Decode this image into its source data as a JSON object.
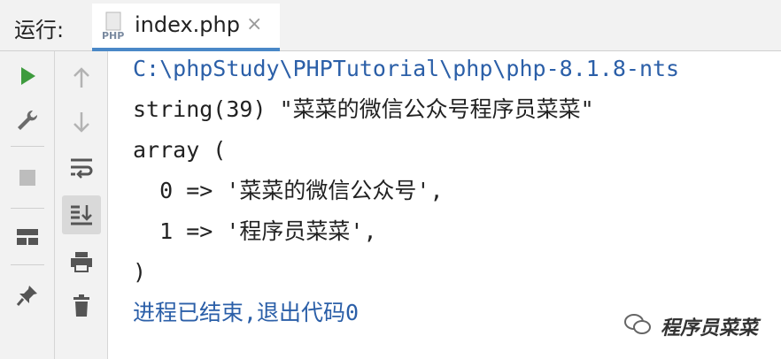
{
  "header": {
    "run_label": "运行:",
    "tab": {
      "icon": "php-file-icon",
      "title": "index.php",
      "close_glyph": "×"
    }
  },
  "toolbar_left": [
    {
      "icon": "run-icon",
      "color": "#3e9b3e"
    },
    {
      "icon": "wrench-icon"
    },
    {
      "icon": "stop-icon"
    },
    {
      "icon": "layout-icon"
    },
    {
      "icon": "pin-icon"
    }
  ],
  "toolbar_right": [
    {
      "icon": "arrow-up-icon"
    },
    {
      "icon": "arrow-down-icon"
    },
    {
      "icon": "soft-wrap-icon"
    },
    {
      "icon": "scroll-to-end-icon",
      "active": true
    },
    {
      "icon": "print-icon"
    },
    {
      "icon": "trash-icon"
    }
  ],
  "console": {
    "lines": [
      "C:\\phpStudy\\PHPTutorial\\php\\php-8.1.8-nts",
      "string(39) \"菜菜的微信公众号程序员菜菜\"",
      "array (",
      "  0 => '菜菜的微信公众号',",
      "  1 => '程序员菜菜',",
      ")",
      "进程已结束,退出代码0"
    ]
  },
  "watermark": {
    "text": "程序员菜菜",
    "icon": "wechat-icon"
  },
  "colors": {
    "path": "#2b5fa8",
    "text": "#222222",
    "tab_underline": "#4a88c7"
  }
}
